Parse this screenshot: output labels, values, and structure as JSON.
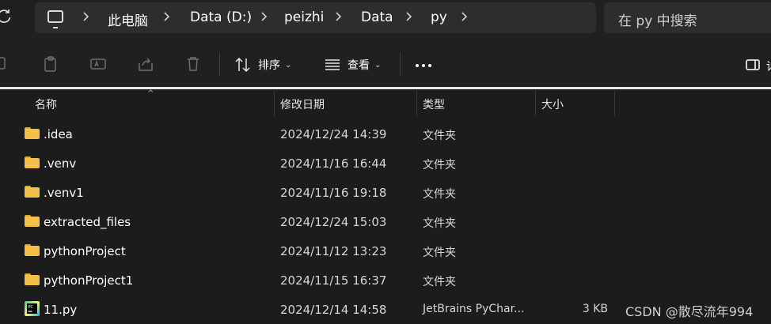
{
  "breadcrumb": {
    "items": [
      "此电脑",
      "Data (D:)",
      "peizhi",
      "Data",
      "py"
    ]
  },
  "search": {
    "placeholder": "在 py 中搜索"
  },
  "toolbar": {
    "sort_label": "排序",
    "view_label": "查看",
    "details_label": "详"
  },
  "columns": {
    "name": "名称",
    "modified": "修改日期",
    "type": "类型",
    "size": "大小"
  },
  "files": [
    {
      "name": ".idea",
      "modified": "2024/12/24 14:39",
      "type": "文件夹",
      "size": "",
      "icon": "folder-icon"
    },
    {
      "name": ".venv",
      "modified": "2024/11/16 16:44",
      "type": "文件夹",
      "size": "",
      "icon": "folder-icon"
    },
    {
      "name": ".venv1",
      "modified": "2024/11/16 19:18",
      "type": "文件夹",
      "size": "",
      "icon": "folder-icon"
    },
    {
      "name": "extracted_files",
      "modified": "2024/12/24 15:03",
      "type": "文件夹",
      "size": "",
      "icon": "folder-icon"
    },
    {
      "name": "pythonProject",
      "modified": "2024/11/12 13:23",
      "type": "文件夹",
      "size": "",
      "icon": "folder-icon"
    },
    {
      "name": "pythonProject1",
      "modified": "2024/11/15 16:37",
      "type": "文件夹",
      "size": "",
      "icon": "folder-icon"
    },
    {
      "name": "11.py",
      "modified": "2024/12/14 14:58",
      "type": "JetBrains PyChar...",
      "size": "3 KB",
      "icon": "pycharm-file-icon"
    }
  ],
  "watermark": "CSDN @散尽流年994",
  "colors": {
    "folder": "#f5c04a",
    "background": "#1c1c1c",
    "bar": "#2d2d2d"
  }
}
